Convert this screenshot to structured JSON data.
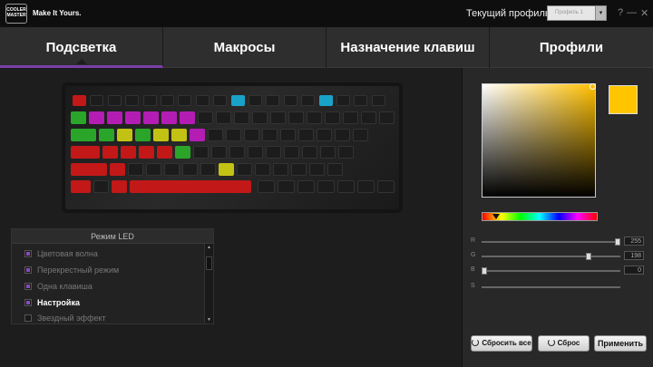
{
  "header": {
    "logo_text": "COOLER MASTER",
    "tagline": "Make It Yours.",
    "current_profile_label": "Текущий профиль",
    "profile_value": "Профиль 1",
    "help": "?",
    "minimize": "—",
    "close": "✕"
  },
  "tabs": [
    "Подсветка",
    "Макросы",
    "Назначение клавиш",
    "Профили"
  ],
  "led_panel": {
    "title": "Режим LED",
    "modes": [
      {
        "label": "Цветовая волна",
        "checked": true,
        "selected": false
      },
      {
        "label": "Перекрестный режим",
        "checked": true,
        "selected": false
      },
      {
        "label": "Одна клавиша",
        "checked": true,
        "selected": false
      },
      {
        "label": "Настройка",
        "checked": true,
        "selected": true
      },
      {
        "label": "Звездный эффект",
        "checked": false,
        "selected": false
      }
    ]
  },
  "color": {
    "current": "#ffc600",
    "R": "255",
    "G": "198",
    "B": "0",
    "s_label": "S",
    "labels": {
      "r": "R",
      "g": "G",
      "b": "B"
    }
  },
  "buttons": {
    "reset_all": "Сбросить все",
    "reset": "Сброс",
    "apply": "Применить"
  },
  "keyboard": {
    "colors": {
      "accent": "#7a3fa8",
      "purple": "#b41db4",
      "green": "#2aa52a",
      "yellow": "#c2c215",
      "red": "#c21818",
      "cyan": "#1aa3c9"
    }
  }
}
